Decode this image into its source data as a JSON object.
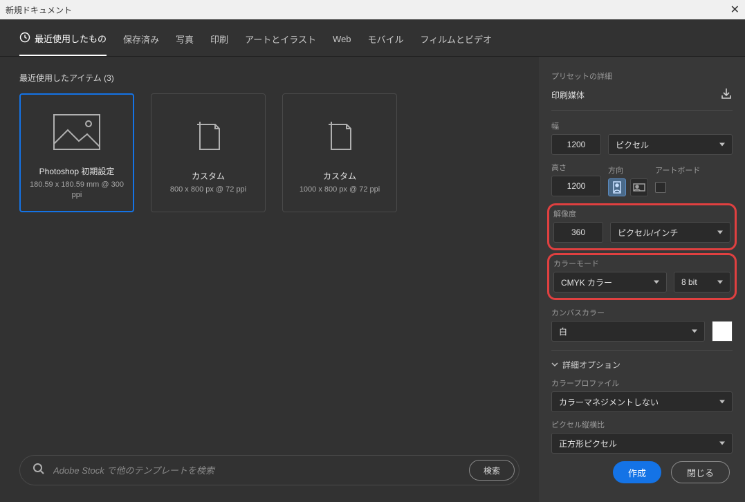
{
  "window": {
    "title": "新規ドキュメント"
  },
  "tabs": [
    "最近使用したもの",
    "保存済み",
    "写真",
    "印刷",
    "アートとイラスト",
    "Web",
    "モバイル",
    "フィルムとビデオ"
  ],
  "recent": {
    "heading": "最近使用したアイテム (3)",
    "items": [
      {
        "title": "Photoshop 初期設定",
        "dims": "180.59 x 180.59 mm @ 300 ppi"
      },
      {
        "title": "カスタム",
        "dims": "800 x 800 px @ 72 ppi"
      },
      {
        "title": "カスタム",
        "dims": "1000 x 800 px @ 72 ppi"
      }
    ]
  },
  "search": {
    "placeholder": "Adobe Stock で他のテンプレートを検索",
    "button": "検索"
  },
  "details": {
    "heading": "プリセットの詳細",
    "preset_name": "印刷媒体",
    "width_label": "幅",
    "width_value": "1200",
    "width_unit": "ピクセル",
    "height_label": "高さ",
    "height_value": "1200",
    "orientation_label": "方向",
    "artboard_label": "アートボード",
    "resolution_label": "解像度",
    "resolution_value": "360",
    "resolution_unit": "ピクセル/インチ",
    "color_mode_label": "カラーモード",
    "color_mode_value": "CMYK カラー",
    "bit_depth": "8 bit",
    "canvas_color_label": "カンバスカラー",
    "canvas_color_value": "白",
    "advanced_label": "詳細オプション",
    "color_profile_label": "カラープロファイル",
    "color_profile_value": "カラーマネジメントしない",
    "pixel_aspect_label": "ピクセル縦横比",
    "pixel_aspect_value": "正方形ピクセル"
  },
  "buttons": {
    "create": "作成",
    "close": "閉じる"
  }
}
